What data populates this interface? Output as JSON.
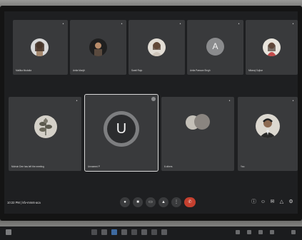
{
  "participants": [
    {
      "name": "Mallika Mudalia",
      "mic_icon": "mic-off-icon"
    },
    {
      "name": "Anita Manjit",
      "mic_icon": "mic-off-icon"
    },
    {
      "name": "Swati Rajo",
      "mic_icon": "mic-off-icon"
    },
    {
      "name": "Anita Paswan Singh",
      "initial": "A",
      "mic_icon": "mic-off-icon"
    },
    {
      "name": "Mitaraj Gujhar",
      "mic_icon": "mic-off-icon"
    },
    {
      "name": "Mohsin Dee has left the meeting",
      "mic_icon": "mic-off-icon"
    },
    {
      "name": "Unnamed P",
      "initial": "U",
      "mic_icon": "mic-icon"
    },
    {
      "name": "6 others",
      "mic_icon": "people-icon"
    },
    {
      "name": "You",
      "mic_icon": "mic-off-icon"
    }
  ],
  "meeting": {
    "time": "10:22 PM",
    "code": "kfv-mmnt-aca"
  },
  "controls": {
    "mic": "mic-off-icon",
    "camera": "camera-off-icon",
    "captions": "captions-icon",
    "present": "present-icon",
    "more": "more-options-icon",
    "end": "end-call-icon"
  },
  "right_controls": [
    "info-icon",
    "people-icon",
    "chat-icon",
    "activities-icon",
    "host-controls-icon"
  ],
  "colors": {
    "tile": "#393a3c",
    "stage": "#1e1f21",
    "end_call": "#c5402f",
    "unnamed_ring": "#7d7e80"
  }
}
